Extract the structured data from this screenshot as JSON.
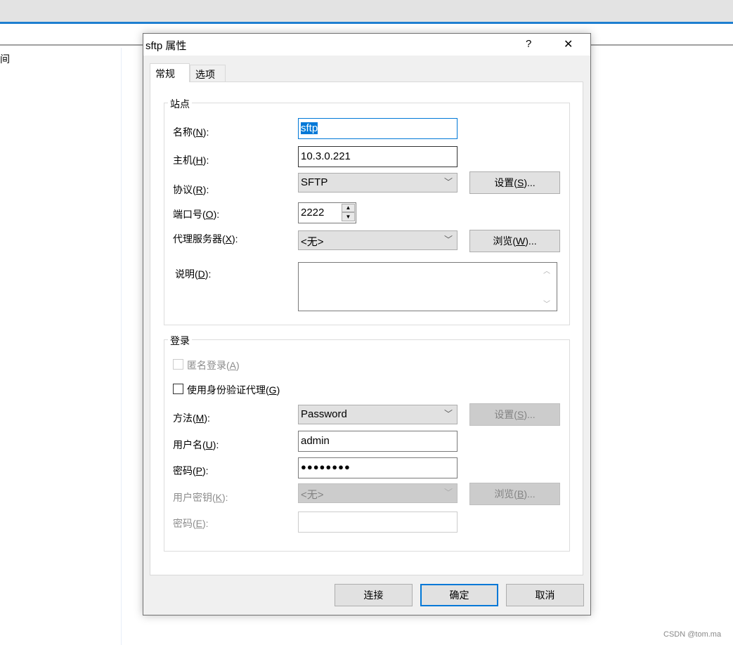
{
  "background": {
    "left_panel_text": "间"
  },
  "dialog": {
    "title": "sftp 属性",
    "help": "?",
    "close": "✕",
    "tabs": [
      {
        "label": "常规"
      },
      {
        "label": "选项"
      }
    ],
    "site": {
      "group_label": "站点",
      "name": {
        "pre": "名称(",
        "key": "N",
        "post": "):",
        "value": "sftp"
      },
      "host": {
        "pre": "主机(",
        "key": "H",
        "post": "):",
        "value": "10.3.0.221"
      },
      "protocol": {
        "pre": "协议(",
        "key": "R",
        "post": "):",
        "value": "SFTP",
        "button": {
          "pre": "设置(",
          "key": "S",
          "post": ")..."
        }
      },
      "port": {
        "pre": "端口号(",
        "key": "O",
        "post": "):",
        "value": "2222"
      },
      "proxy": {
        "pre": "代理服务器(",
        "key": "X",
        "post": "):",
        "value": "<无>",
        "button": {
          "pre": "浏览(",
          "key": "W",
          "post": ")..."
        }
      },
      "description": {
        "pre": "说明(",
        "key": "D",
        "post": "):",
        "value": ""
      }
    },
    "login": {
      "group_label": "登录",
      "anonymous": {
        "pre": "匿名登录(",
        "key": "A",
        "post": ")"
      },
      "agent": {
        "pre": "使用身份验证代理(",
        "key": "G",
        "post": ")"
      },
      "method": {
        "pre": "方法(",
        "key": "M",
        "post": "):",
        "value": "Password",
        "button": {
          "pre": "设置(",
          "key": "S",
          "post": ")..."
        }
      },
      "username": {
        "pre": "用户名(",
        "key": "U",
        "post": "):",
        "value": "admin"
      },
      "password": {
        "pre": "密码(",
        "key": "P",
        "post": "):",
        "value": "●●●●●●●●"
      },
      "user_key": {
        "pre": "用户密钥(",
        "key": "K",
        "post": "):",
        "value": "<无>",
        "button": {
          "pre": "浏览(",
          "key": "B",
          "post": ")..."
        }
      },
      "passphrase": {
        "pre": "密码(",
        "key": "E",
        "post": "):",
        "value": ""
      }
    },
    "buttons": {
      "connect": "连接",
      "ok": "确定",
      "cancel": "取消"
    }
  },
  "watermark": "CSDN @tom.ma"
}
